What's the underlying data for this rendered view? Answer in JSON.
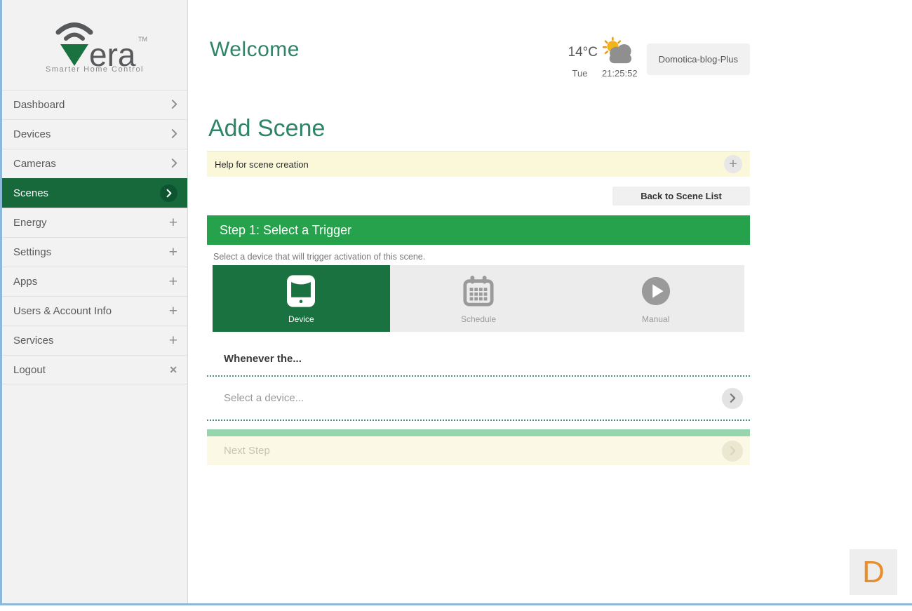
{
  "brand": {
    "wordmark_suffix": "era",
    "trademark": "TM",
    "tagline": "Smarter Home Control"
  },
  "sidebar": {
    "items": [
      {
        "label": "Dashboard",
        "icon": "chevron-right"
      },
      {
        "label": "Devices",
        "icon": "chevron-right"
      },
      {
        "label": "Cameras",
        "icon": "chevron-right"
      },
      {
        "label": "Scenes",
        "icon": "chevron-right-circle",
        "selected": true
      },
      {
        "label": "Energy",
        "icon": "plus"
      },
      {
        "label": "Settings",
        "icon": "plus"
      },
      {
        "label": "Apps",
        "icon": "plus"
      },
      {
        "label": "Users & Account Info",
        "icon": "plus"
      },
      {
        "label": "Services",
        "icon": "plus"
      },
      {
        "label": "Logout",
        "icon": "close"
      }
    ]
  },
  "header": {
    "title": "Welcome",
    "weather": {
      "temperature": "14°C",
      "day": "Tue",
      "time": "21:25:52",
      "icon": "sun-behind-cloud"
    },
    "controller_name": "Domotica-blog-Plus"
  },
  "scene_page": {
    "title": "Add Scene",
    "help_label": "Help for scene creation",
    "back_button": "Back to Scene List"
  },
  "step1": {
    "title": "Step 1: Select a Trigger",
    "caption": "Select a device that will trigger activation of this scene.",
    "triggers": [
      {
        "label": "Device",
        "icon": "device-controller",
        "selected": true
      },
      {
        "label": "Schedule",
        "icon": "calendar",
        "selected": false
      },
      {
        "label": "Manual",
        "icon": "play-circle",
        "selected": false
      }
    ],
    "whenever_label": "Whenever the...",
    "device_select_label": "Select a device...",
    "next_button": "Next Step"
  },
  "account_badge": {
    "letter": "D"
  },
  "colors": {
    "step_green": "#25a24b",
    "tile_green": "#1a7240",
    "sidebar_selected_green": "#17693c",
    "heading_teal": "#2e8467",
    "help_yellow": "#fbf8d9",
    "next_yellow": "#fbf9e6",
    "mint_strip": "#97d5ae",
    "edge_blue": "#8cb8da",
    "badge_orange": "#e78f2e"
  }
}
